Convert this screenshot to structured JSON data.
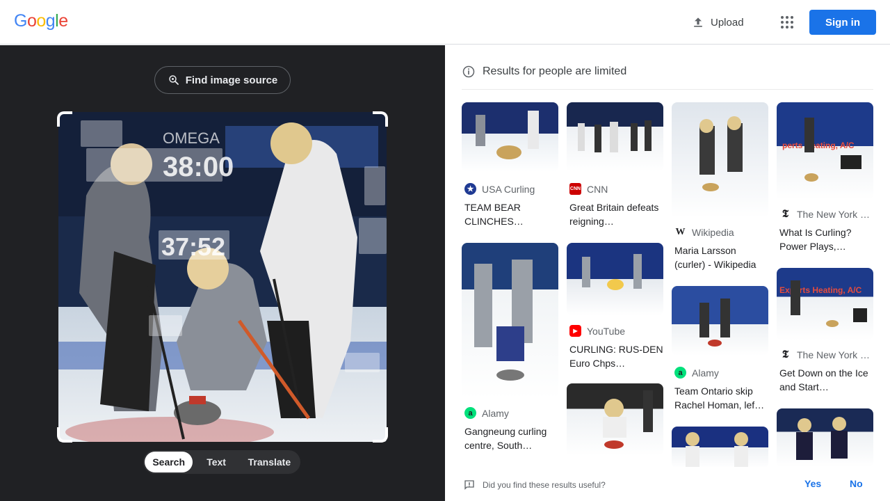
{
  "header": {
    "logo_letters": [
      {
        "ch": "G",
        "color": "#4285f4"
      },
      {
        "ch": "o",
        "color": "#ea4335"
      },
      {
        "ch": "o",
        "color": "#fbbc05"
      },
      {
        "ch": "g",
        "color": "#4285f4"
      },
      {
        "ch": "l",
        "color": "#34a853"
      },
      {
        "ch": "e",
        "color": "#ea4335"
      }
    ],
    "upload_label": "Upload",
    "signin_label": "Sign in"
  },
  "left_panel": {
    "find_source_label": "Find image source",
    "tabs": [
      "Search",
      "Text",
      "Translate"
    ],
    "active_tab": "Search",
    "scoreboard_top": "38:00",
    "scoreboard_mid": "37:52",
    "logo_text": "OMEGA"
  },
  "results": {
    "notice": "Results for people are limited",
    "cards": [
      {
        "source": "USA Curling",
        "title": "TEAM BEAR CLINCHES…",
        "fav_text": "★",
        "fav_bg": "#1f3a93",
        "fav_fg": "#fff"
      },
      {
        "source": "CNN",
        "title": "Great Britain defeats reigning…",
        "fav_text": "CNN",
        "fav_bg": "#cc0000",
        "fav_fg": "#fff"
      },
      {
        "source": "Wikipedia",
        "title": "Maria Larsson (curler) - Wikipedia",
        "fav_text": "W",
        "fav_bg": "#fff",
        "fav_fg": "#202124"
      },
      {
        "source": "The New York …",
        "title": "What Is Curling? Power Plays,…",
        "fav_text": "𝕿",
        "fav_bg": "#fff",
        "fav_fg": "#202124"
      },
      {
        "source": "Alamy",
        "title": "Gangneung curling centre, South…",
        "fav_text": "a",
        "fav_bg": "#00e07b",
        "fav_fg": "#202124"
      },
      {
        "source": "YouTube",
        "title": "CURLING: RUS-DEN Euro Chps…",
        "fav_text": "▶",
        "fav_bg": "#ff0000",
        "fav_fg": "#fff"
      },
      {
        "source": "Alamy",
        "title": "Team Ontario skip Rachel Homan, lef…",
        "fav_text": "a",
        "fav_bg": "#00e07b",
        "fav_fg": "#202124"
      },
      {
        "source": "The New York …",
        "title": "Get Down on the Ice and Start…",
        "fav_text": "𝕿",
        "fav_bg": "#fff",
        "fav_fg": "#202124"
      }
    ]
  },
  "feedback": {
    "question": "Did you find these results useful?",
    "yes": "Yes",
    "no": "No"
  }
}
